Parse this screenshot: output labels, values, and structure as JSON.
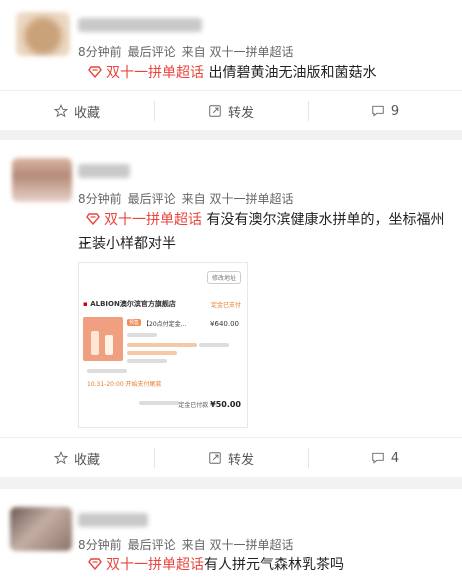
{
  "colors": {
    "topic": "#e8453c",
    "meta": "#666666",
    "background": "#f2f2f2"
  },
  "posts": [
    {
      "time": "8分钟前",
      "last_comment": "最后评论",
      "source": "来自 双十一拼单超话",
      "topic": "双十一拼单超话",
      "text": "出倩碧黄油无油版和菌菇水",
      "actions": {
        "favorite": "收藏",
        "repost": "转发",
        "comments": "9"
      }
    },
    {
      "time": "8分钟前",
      "last_comment": "最后评论",
      "source": "来自 双十一拼单超话",
      "topic": "双十一拼单超话",
      "text": "有没有澳尔滨健康水拼单的，坐标福州~",
      "text_line2": "正装小样都对半",
      "actions": {
        "favorite": "收藏",
        "repost": "转发",
        "comments": "4"
      },
      "screenshot": {
        "address_button": "修改地址",
        "store": "ALBION澳尔滨官方旗舰店",
        "status": "定金已支付",
        "tag": "预售",
        "title": "【20点付定金…",
        "price": "¥640.00",
        "time_note": "10.31-20:00 开始支付尾款",
        "total_label": "定金已付款",
        "total_value": "¥50.00"
      }
    },
    {
      "time": "8分钟前",
      "last_comment": "最后评论",
      "source": "来自 双十一拼单超话",
      "topic": "双十一拼单超话",
      "text": "有人拼元气森林乳茶吗"
    }
  ]
}
